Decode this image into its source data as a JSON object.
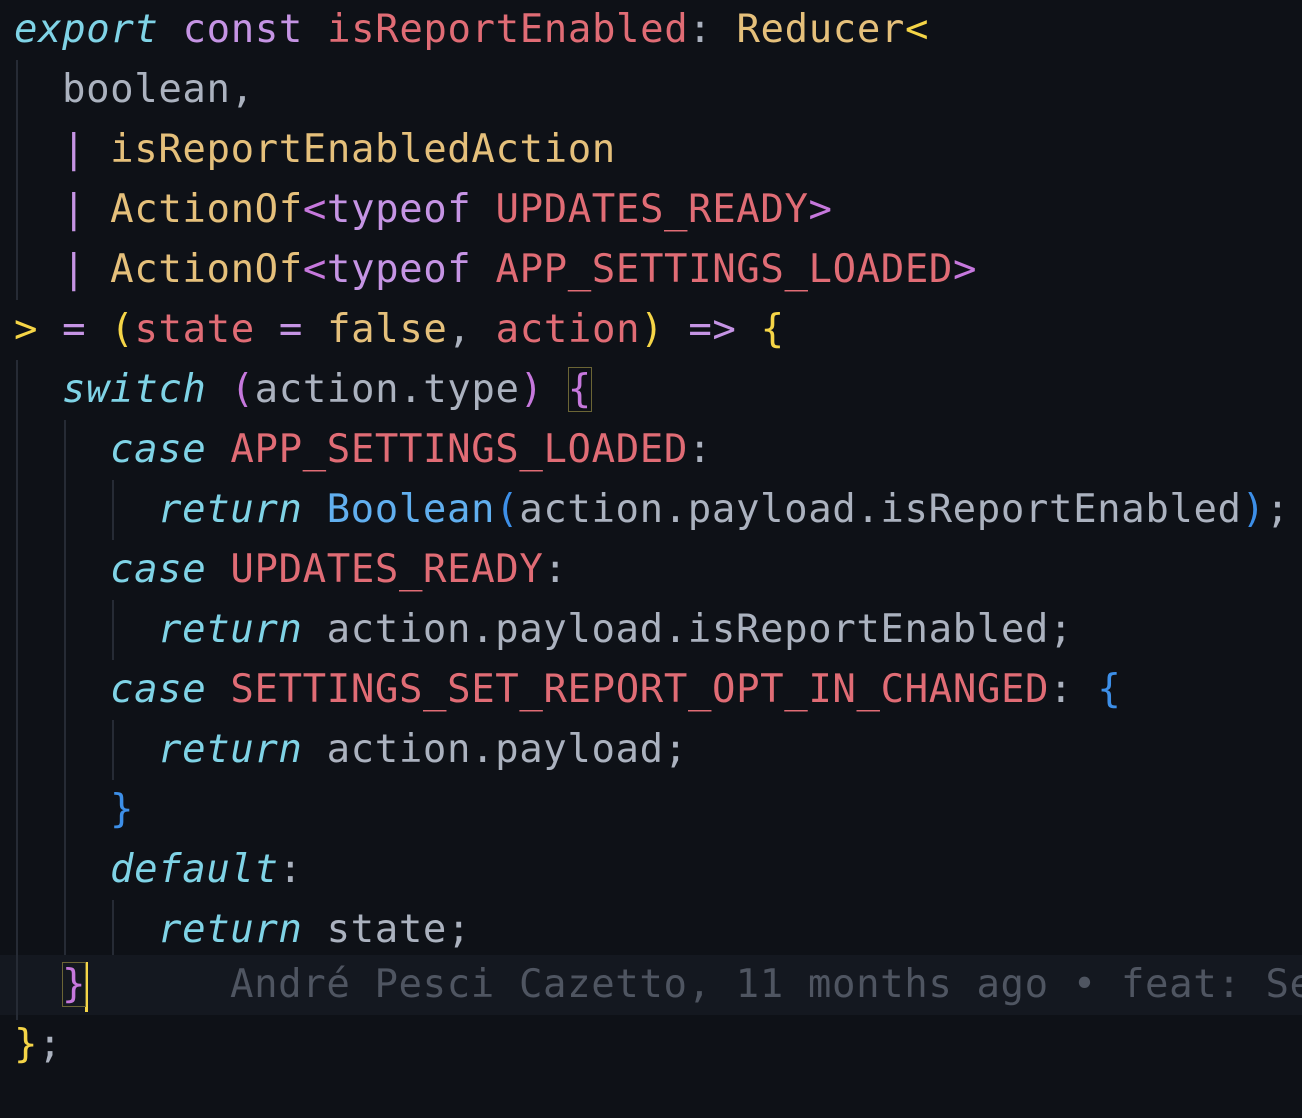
{
  "editor": {
    "code_lines": [
      [
        "export",
        " ",
        "const",
        " ",
        "isReportEnabled",
        ": ",
        "Reducer",
        "<"
      ],
      [
        "boolean,"
      ],
      [
        "| ",
        "isReportEnabledAction"
      ],
      [
        "| ",
        "ActionOf",
        "<",
        "typeof",
        " ",
        "UPDATES_READY",
        ">"
      ],
      [
        "| ",
        "ActionOf",
        "<",
        "typeof",
        " ",
        "APP_SETTINGS_LOADED",
        ">"
      ],
      [
        ">",
        " = ",
        "(",
        "state",
        " = ",
        "false",
        ", ",
        "action",
        ")",
        " => ",
        "{"
      ],
      [
        "switch",
        " ",
        "(",
        "action.type",
        ")",
        " ",
        "{"
      ],
      [
        "case",
        " ",
        "APP_SETTINGS_LOADED",
        ":"
      ],
      [
        "return",
        " ",
        "Boolean",
        "(",
        "action.payload.isReportEnabled",
        ")",
        ";"
      ],
      [
        "case",
        " ",
        "UPDATES_READY",
        ":"
      ],
      [
        "return",
        " ",
        "action.payload.isReportEnabled;"
      ],
      [
        "case",
        " ",
        "SETTINGS_SET_REPORT_OPT_IN_CHANGED",
        ": ",
        "{"
      ],
      [
        "return",
        " ",
        "action.payload;"
      ],
      [
        "}"
      ],
      [
        "default",
        ":"
      ],
      [
        "return",
        " ",
        "state;"
      ],
      [
        "}"
      ],
      [
        "}",
        ";"
      ]
    ],
    "blame_annotation": "André Pesci Cazetto, 11 months ago • feat: Se"
  },
  "colors": {
    "background": "#0e1117",
    "current_line": "#141820",
    "keyword_italic": "#7fd3e6",
    "keyword": "#c594e4",
    "constant": "#e06c75",
    "type": "#e5c07b",
    "function": "#61afef",
    "bracket_yellow": "#f5d547",
    "bracket_purple": "#c678dd",
    "bracket_blue": "#3d8fe8",
    "blame_text": "#4f5561",
    "cursor": "#f5d547"
  }
}
